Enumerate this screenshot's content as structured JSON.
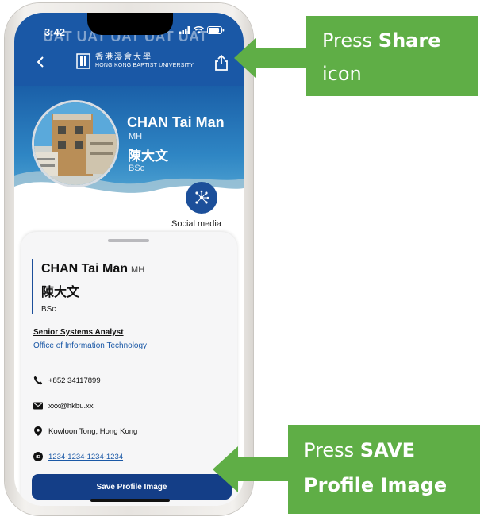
{
  "status_bar": {
    "time": "3:42",
    "watermark": "UAT UAT UAT UAT UAT",
    "icons": [
      "signal-icon",
      "wifi-icon",
      "battery-icon"
    ]
  },
  "app_header": {
    "logo_zh": "香港浸會大學",
    "logo_en": "HONG KONG BAPTIST UNIVERSITY",
    "icons": [
      "back-arrow-icon",
      "share-icon"
    ]
  },
  "profile": {
    "name": "CHAN Tai Man",
    "title": "MH",
    "chinese_name": "陳大文",
    "degree": "BSc",
    "position": "Senior Systems Analyst",
    "department": "Office of Information Technology",
    "phone": "+852 34117899",
    "email": "xxx@hkbu.xx",
    "location": "Kowloon Tong, Hong Kong",
    "orcid": "1234-1234-1234-1234"
  },
  "social": {
    "label": "Social media",
    "icon": "network-icon"
  },
  "save_button": {
    "label": "Save Profile Image"
  },
  "callouts": {
    "share": {
      "prefix": "Press ",
      "bold": "Share",
      "suffix": "icon"
    },
    "save": {
      "prefix": "Press ",
      "bold_1": "SAVE",
      "bold_2": "Profile Image"
    }
  },
  "colors": {
    "header_blue": "#1a58a6",
    "button_navy": "#143e87",
    "callout_green": "#5fae46"
  }
}
